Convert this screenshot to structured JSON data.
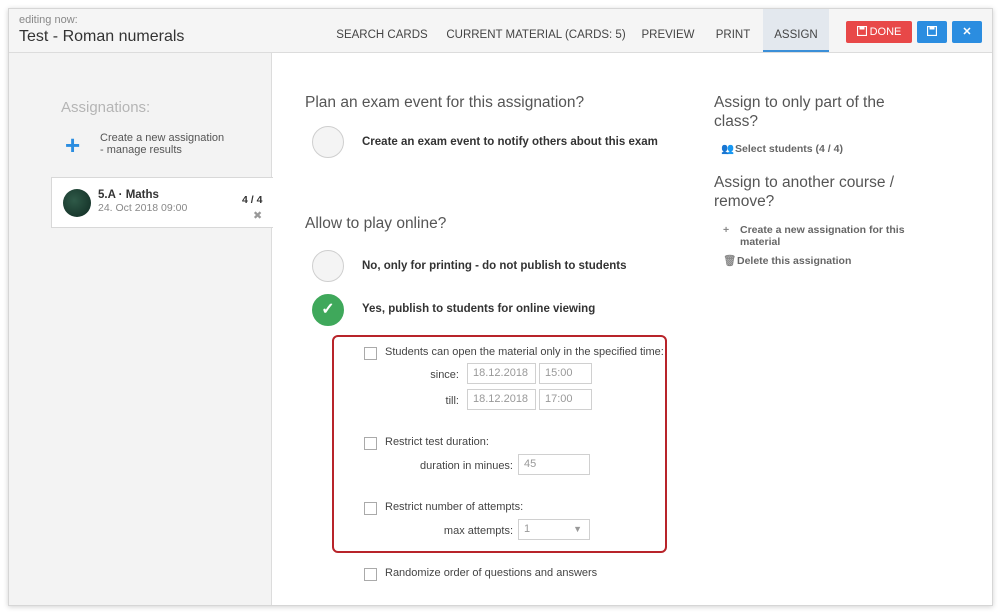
{
  "header": {
    "editing_label": "editing now:",
    "title": "Test - Roman numerals",
    "tabs": [
      {
        "label": "SEARCH CARDS"
      },
      {
        "label": "CURRENT MATERIAL (CARDS: 5)"
      },
      {
        "label": "PREVIEW"
      },
      {
        "label": "PRINT"
      },
      {
        "label": "ASSIGN",
        "active": true
      }
    ],
    "done_label": "DONE",
    "done_icon": "save-icon",
    "save_icon": "floppy-icon",
    "close_icon": "close-icon",
    "colors": {
      "done": "#e84848",
      "blue": "#2b8de0"
    }
  },
  "sidebar": {
    "heading": "Assignations:",
    "create_line1": "Create a new assignation",
    "create_line2": "- manage results",
    "assignment": {
      "title": "5.A · Maths",
      "date": "24. Oct 2018 09:00",
      "count": "4 / 4"
    }
  },
  "main": {
    "exam_title": "Plan an exam event for this assignation?",
    "exam_option": "Create an exam event to notify others about this exam",
    "online_title": "Allow to play online?",
    "no_option": "No, only for printing - do not publish to students",
    "yes_option": "Yes, publish to students for online viewing",
    "restrict_time": {
      "label": "Students can open the material only in the specified time:",
      "since_label": "since:",
      "since_date": "18.12.2018",
      "since_time": "15:00",
      "till_label": "till:",
      "till_date": "18.12.2018",
      "till_time": "17:00"
    },
    "restrict_duration": {
      "label": "Restrict test duration:",
      "duration_label": "duration in minues:",
      "duration_value": "45"
    },
    "restrict_attempts": {
      "label": "Restrict number of attempts:",
      "max_label": "max attempts:",
      "max_value": "1"
    },
    "randomize_label": "Randomize order of questions and answers"
  },
  "right": {
    "part_title": "Assign to only part of the class?",
    "select_students": "Select students (4 / 4)",
    "course_title": "Assign to another course / remove?",
    "create_for_material": "Create a new assignation for this material",
    "delete": "Delete this assignation"
  }
}
